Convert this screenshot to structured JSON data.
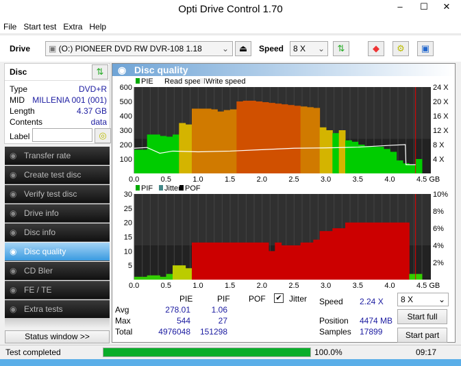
{
  "window": {
    "title": "Opti Drive Control 1.70",
    "minimize": "‒",
    "maximize": "☐",
    "close": "✕"
  },
  "menu": [
    "File",
    "Start test",
    "Extra",
    "Help"
  ],
  "toolbar": {
    "drive_label": "Drive",
    "drive_value": "(O:)   PIONEER DVD RW  DVR-108 1.18",
    "speed_label": "Speed",
    "speed_value": "8 X"
  },
  "disc": {
    "header": "Disc",
    "rows": [
      {
        "k": "Type",
        "v": "DVD+R"
      },
      {
        "k": "MID",
        "v": "MILLENIA 001 (001)"
      },
      {
        "k": "Length",
        "v": "4.37 GB"
      },
      {
        "k": "Contents",
        "v": "data"
      }
    ],
    "label_label": "Label",
    "label_value": ""
  },
  "nav": [
    {
      "label": "Transfer rate"
    },
    {
      "label": "Create test disc"
    },
    {
      "label": "Verify test disc"
    },
    {
      "label": "Drive info"
    },
    {
      "label": "Disc info"
    },
    {
      "label": "Disc quality",
      "active": true
    },
    {
      "label": "CD Bler"
    },
    {
      "label": "FE / TE"
    },
    {
      "label": "Extra tests"
    }
  ],
  "status_window_button": "Status window >>",
  "panel": {
    "title": "Disc quality"
  },
  "stats": {
    "col_pie": "PIE",
    "col_pif": "PIF",
    "col_pof": "POF",
    "jitter_label": "Jitter",
    "jitter_checked": true,
    "rows": [
      {
        "k": "Avg",
        "pie": "278.01",
        "pif": "1.06"
      },
      {
        "k": "Max",
        "pie": "544",
        "pif": "27"
      },
      {
        "k": "Total",
        "pie": "4976048",
        "pif": "151298"
      }
    ],
    "speed_label": "Speed",
    "speed_value": "2.24 X",
    "position_label": "Position",
    "position_value": "4474 MB",
    "samples_label": "Samples",
    "samples_value": "17899",
    "speed_select": "8 X",
    "start_full": "Start full",
    "start_part": "Start part"
  },
  "statusbar": {
    "text": "Test completed",
    "progress_percent": 100,
    "progress_text": "100.0%",
    "time": "09:17"
  },
  "colors": {
    "accent": "#3a9ae0",
    "pie_green": "#00cc00",
    "pif_red": "#cc0000",
    "progress": "#0aad2a"
  },
  "chart_data": [
    {
      "type": "bar",
      "legend": [
        "PIE",
        "Read speed",
        "Write speed"
      ],
      "xlabel": "GB",
      "xlim": [
        0,
        4.5
      ],
      "ylim": [
        0,
        600
      ],
      "y2lim": [
        0,
        24
      ],
      "xticks": [
        "0.0",
        "0.5",
        "1.0",
        "1.5",
        "2.0",
        "2.5",
        "3.0",
        "3.5",
        "4.0",
        "4.5 GB"
      ],
      "yticks": [
        "100",
        "200",
        "300",
        "400",
        "500",
        "600"
      ],
      "y2ticks": [
        "4 X",
        "8 X",
        "12 X",
        "16 X",
        "20 X",
        "24 X"
      ],
      "pie_x": [
        0,
        0.1,
        0.2,
        0.3,
        0.4,
        0.5,
        0.6,
        0.7,
        0.8,
        0.9,
        1.0,
        1.1,
        1.2,
        1.3,
        1.4,
        1.5,
        1.6,
        1.7,
        1.8,
        1.9,
        2.0,
        2.1,
        2.2,
        2.3,
        2.4,
        2.5,
        2.6,
        2.7,
        2.8,
        2.9,
        3.0,
        3.1,
        3.2,
        3.3,
        3.4,
        3.5,
        3.6,
        3.7,
        3.8,
        3.9,
        4.0,
        4.1,
        4.2,
        4.3,
        4.4
      ],
      "pie": [
        165,
        165,
        270,
        270,
        260,
        255,
        270,
        350,
        340,
        450,
        450,
        450,
        445,
        430,
        440,
        445,
        500,
        505,
        505,
        500,
        495,
        490,
        485,
        480,
        475,
        470,
        465,
        460,
        455,
        320,
        300,
        280,
        300,
        230,
        220,
        200,
        190,
        185,
        185,
        170,
        150,
        90,
        70,
        60,
        100
      ],
      "read_speed_x": [
        0,
        0.2,
        0.4,
        0.6,
        1.0,
        1.5,
        2.0,
        2.5,
        3.0,
        3.5,
        4.0,
        4.24,
        4.25,
        4.4
      ],
      "read_speed": [
        7.0,
        7.2,
        5.6,
        6.2,
        6.0,
        6.2,
        6.6,
        7.0,
        7.1,
        7.3,
        7.8,
        8.0,
        2.4,
        2.4
      ]
    },
    {
      "type": "bar",
      "legend": [
        "PIF",
        "Jitter",
        "POF"
      ],
      "xlabel": "GB",
      "xlim": [
        0,
        4.5
      ],
      "ylim": [
        0,
        30
      ],
      "y2lim": [
        0,
        10
      ],
      "xticks": [
        "0.0",
        "0.5",
        "1.0",
        "1.5",
        "2.0",
        "2.5",
        "3.0",
        "3.5",
        "4.0",
        "4.5 GB"
      ],
      "yticks": [
        "5",
        "10",
        "15",
        "20",
        "25",
        "30"
      ],
      "y2ticks": [
        "2%",
        "4%",
        "6%",
        "8%",
        "10%"
      ],
      "pif_x": [
        0,
        0.1,
        0.2,
        0.3,
        0.4,
        0.5,
        0.6,
        0.7,
        0.8,
        0.9,
        1.0,
        1.1,
        1.2,
        1.3,
        1.4,
        1.5,
        1.6,
        1.7,
        1.8,
        1.9,
        2.0,
        2.1,
        2.2,
        2.3,
        2.4,
        2.5,
        2.6,
        2.7,
        2.8,
        2.9,
        3.0,
        3.1,
        3.2,
        3.3,
        3.4,
        3.5,
        3.6,
        3.7,
        3.8,
        3.9,
        4.0,
        4.1,
        4.2,
        4.3,
        4.4
      ],
      "pif": [
        1,
        1,
        1.5,
        1.5,
        1,
        2,
        5,
        5,
        4,
        13,
        13,
        13,
        13,
        13,
        13,
        13,
        13,
        13,
        13,
        13,
        13,
        10,
        13,
        12,
        12,
        12,
        13,
        13,
        14,
        17,
        17,
        18,
        18,
        20,
        20,
        20,
        20,
        20,
        20,
        20,
        20,
        20,
        20,
        2,
        2
      ]
    }
  ]
}
